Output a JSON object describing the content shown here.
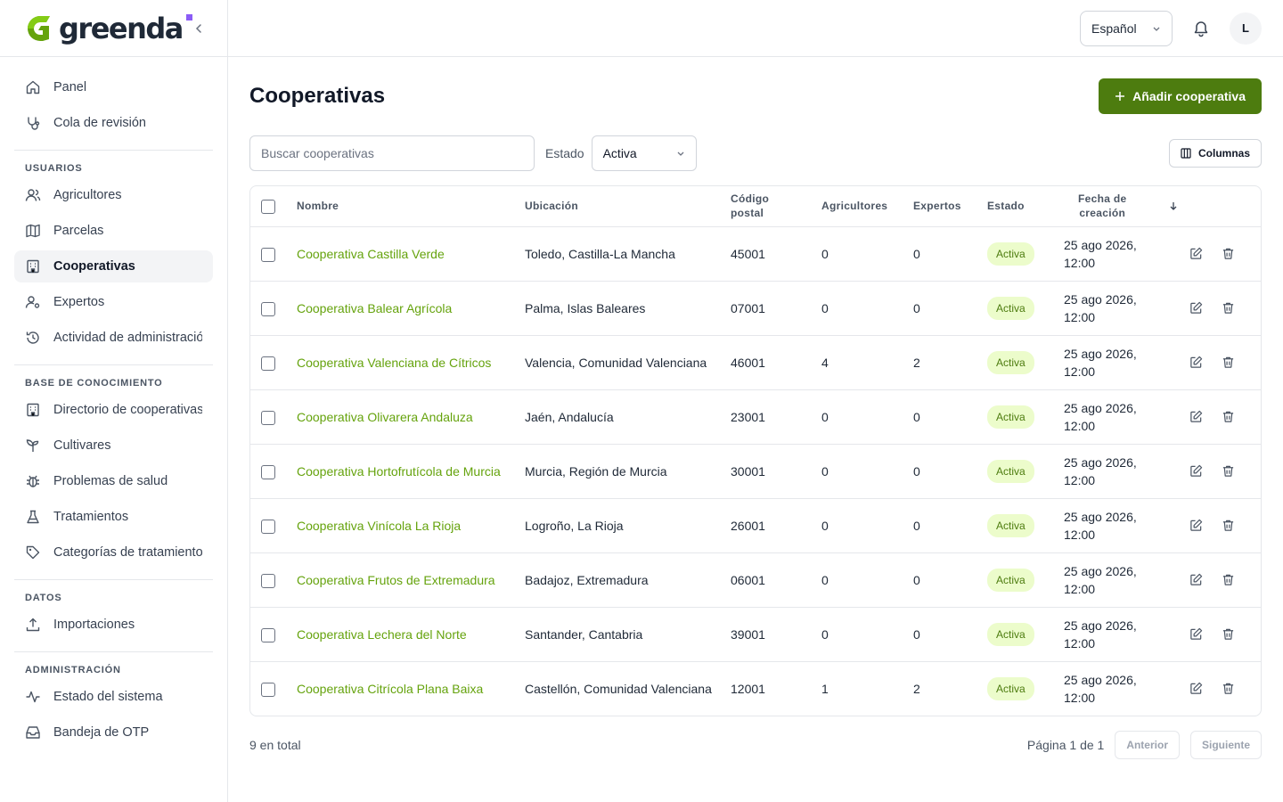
{
  "brand": {
    "name": "greenda",
    "accent": "#8b5cf6",
    "primary": "#4d7c0f"
  },
  "sidebar": {
    "items_top": [
      {
        "label": "Panel",
        "icon": "home-icon"
      },
      {
        "label": "Cola de revisión",
        "icon": "stethoscope-icon"
      }
    ],
    "sections": [
      {
        "title": "USUARIOS",
        "items": [
          {
            "label": "Agricultores",
            "icon": "users-icon"
          },
          {
            "label": "Parcelas",
            "icon": "map-icon"
          },
          {
            "label": "Cooperativas",
            "icon": "building-icon",
            "active": true
          },
          {
            "label": "Expertos",
            "icon": "user-cog-icon"
          },
          {
            "label": "Actividad de administración",
            "icon": "history-icon"
          }
        ]
      },
      {
        "title": "BASE DE CONOCIMIENTO",
        "items": [
          {
            "label": "Directorio de cooperativas",
            "icon": "building-icon"
          },
          {
            "label": "Cultivares",
            "icon": "sprout-icon"
          },
          {
            "label": "Problemas de salud",
            "icon": "bug-icon"
          },
          {
            "label": "Tratamientos",
            "icon": "flask-icon"
          },
          {
            "label": "Categorías de tratamiento",
            "icon": "tag-icon"
          }
        ]
      },
      {
        "title": "DATOS",
        "items": [
          {
            "label": "Importaciones",
            "icon": "upload-icon"
          }
        ]
      },
      {
        "title": "ADMINISTRACIÓN",
        "items": [
          {
            "label": "Estado del sistema",
            "icon": "activity-icon"
          },
          {
            "label": "Bandeja de OTP",
            "icon": "inbox-icon"
          }
        ]
      }
    ]
  },
  "topbar": {
    "language": "Español",
    "avatar_initial": "L"
  },
  "page": {
    "title": "Cooperativas",
    "add_button": "Añadir cooperativa",
    "search_placeholder": "Buscar cooperativas",
    "filter_label": "Estado",
    "filter_value": "Activa",
    "columns_button": "Columnas"
  },
  "table": {
    "headers": {
      "name": "Nombre",
      "location": "Ubicación",
      "postal_line1": "Código",
      "postal_line2": "postal",
      "farmers": "Agricultores",
      "experts": "Expertos",
      "status": "Estado",
      "created_line1": "Fecha de",
      "created_line2": "creación"
    },
    "rows": [
      {
        "name": "Cooperativa Castilla Verde",
        "location": "Toledo, Castilla-La Mancha",
        "postal": "45001",
        "farmers": "0",
        "experts": "0",
        "status": "Activa",
        "date": "25 ago 2026,",
        "time": "12:00"
      },
      {
        "name": "Cooperativa Balear Agrícola",
        "location": "Palma, Islas Baleares",
        "postal": "07001",
        "farmers": "0",
        "experts": "0",
        "status": "Activa",
        "date": "25 ago 2026,",
        "time": "12:00"
      },
      {
        "name": "Cooperativa Valenciana de Cítricos",
        "location": "Valencia, Comunidad Valenciana",
        "postal": "46001",
        "farmers": "4",
        "experts": "2",
        "status": "Activa",
        "date": "25 ago 2026,",
        "time": "12:00"
      },
      {
        "name": "Cooperativa Olivarera Andaluza",
        "location": "Jaén, Andalucía",
        "postal": "23001",
        "farmers": "0",
        "experts": "0",
        "status": "Activa",
        "date": "25 ago 2026,",
        "time": "12:00"
      },
      {
        "name": "Cooperativa Hortofrutícola de Murcia",
        "location": "Murcia, Región de Murcia",
        "postal": "30001",
        "farmers": "0",
        "experts": "0",
        "status": "Activa",
        "date": "25 ago 2026,",
        "time": "12:00"
      },
      {
        "name": "Cooperativa Vinícola La Rioja",
        "location": "Logroño, La Rioja",
        "postal": "26001",
        "farmers": "0",
        "experts": "0",
        "status": "Activa",
        "date": "25 ago 2026,",
        "time": "12:00"
      },
      {
        "name": "Cooperativa Frutos de Extremadura",
        "location": "Badajoz, Extremadura",
        "postal": "06001",
        "farmers": "0",
        "experts": "0",
        "status": "Activa",
        "date": "25 ago 2026,",
        "time": "12:00"
      },
      {
        "name": "Cooperativa Lechera del Norte",
        "location": "Santander, Cantabria",
        "postal": "39001",
        "farmers": "0",
        "experts": "0",
        "status": "Activa",
        "date": "25 ago 2026,",
        "time": "12:00"
      },
      {
        "name": "Cooperativa Citrícola Plana Baixa",
        "location": "Castellón, Comunidad Valenciana",
        "postal": "12001",
        "farmers": "1",
        "experts": "2",
        "status": "Activa",
        "date": "25 ago 2026,",
        "time": "12:00"
      }
    ]
  },
  "pagination": {
    "total": "9 en total",
    "page_info": "Página 1 de 1",
    "prev": "Anterior",
    "next": "Siguiente"
  }
}
